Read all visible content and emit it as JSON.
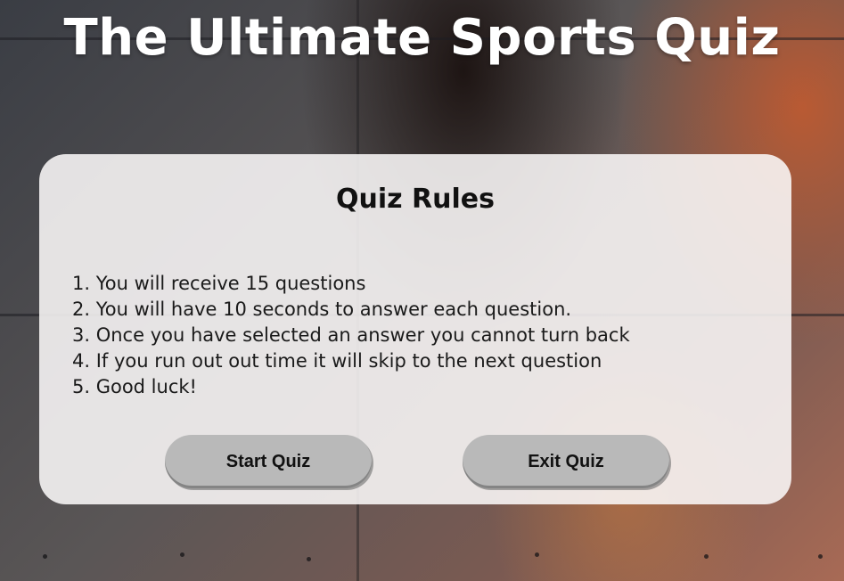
{
  "page": {
    "title": "The Ultimate Sports Quiz"
  },
  "rules_card": {
    "heading": "Quiz Rules",
    "rules": [
      "1. You will receive 15 questions",
      "2. You will have 10 seconds to answer each question.",
      "3. Once you have selected an answer you cannot turn back",
      "4. If you run out out time it will skip to the next question",
      "5. Good luck!"
    ],
    "start_label": "Start Quiz",
    "exit_label": "Exit Quiz"
  },
  "colors": {
    "title_text": "#ffffff",
    "card_background": "#faf8f8",
    "button_background": "#b9b9b9",
    "text": "#111111"
  }
}
